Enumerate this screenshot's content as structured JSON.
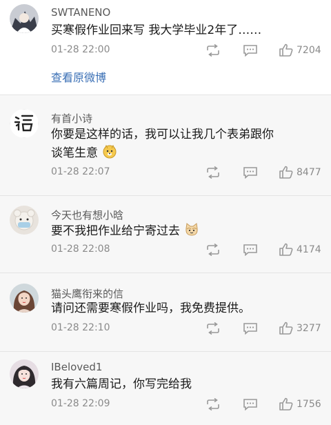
{
  "comments": [
    {
      "username": "SWTANENO",
      "text": "买寒假作业回来写 我大学毕业2年了……",
      "time": "01-28 22:00",
      "likes": "7204",
      "avatar_icon": "anime-avatar-icon"
    },
    {
      "username": "有首小诗",
      "text_line1": "你要是这样的话，我可以让我几个表弟跟你",
      "text_line2": "谈笔生意",
      "time": "01-28 22:07",
      "likes": "8477",
      "avatar_icon": "calligraphy-avatar-icon",
      "emoji": "doge-emoji-icon"
    },
    {
      "username": "今天也有想小晗",
      "text": "要不我把作业给宁寄过去",
      "time": "01-28 22:08",
      "likes": "4174",
      "avatar_icon": "plush-toy-avatar-icon",
      "emoji": "cat-emoji-icon"
    },
    {
      "username": "猫头鹰衔来的信",
      "text": "请问还需要寒假作业吗，我免费提供。",
      "time": "01-28 22:10",
      "likes": "3277",
      "avatar_icon": "girl-avatar-icon"
    },
    {
      "username": "IBeloved1",
      "text": "我有六篇周记，你写完给我",
      "time": "01-28 22:09",
      "likes": "1756",
      "avatar_icon": "girl-avatar-icon"
    }
  ],
  "view_original_label": "查看原微博",
  "colors": {
    "link": "#3a6fb5",
    "background": "#f7f7f7",
    "first_card": "#ffffff"
  }
}
